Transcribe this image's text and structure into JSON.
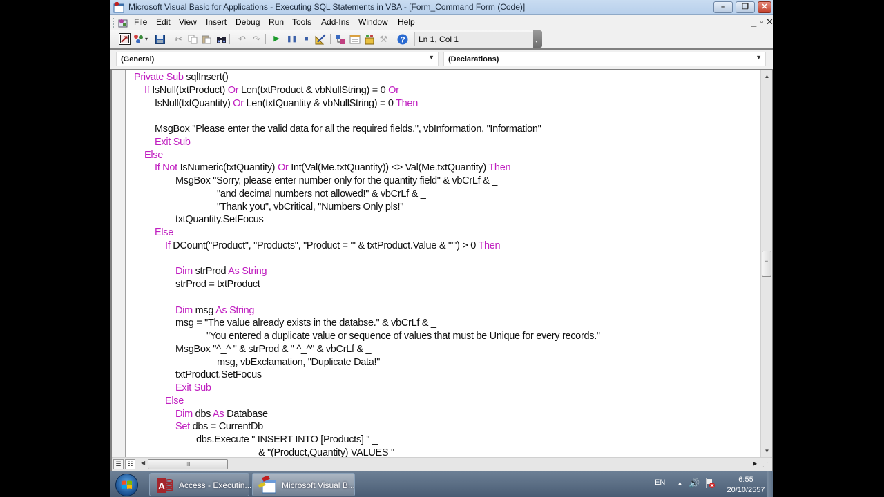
{
  "window": {
    "title": "Microsoft Visual Basic for Applications - Executing SQL Statements in VBA - [Form_Command Form (Code)]",
    "controls": {
      "minimize": "–",
      "restore": "❐",
      "close": "✕"
    }
  },
  "menubar": {
    "items": [
      {
        "label": "File",
        "accel": "F"
      },
      {
        "label": "Edit",
        "accel": "E"
      },
      {
        "label": "View",
        "accel": "V"
      },
      {
        "label": "Insert",
        "accel": "I"
      },
      {
        "label": "Debug",
        "accel": "D"
      },
      {
        "label": "Run",
        "accel": "R"
      },
      {
        "label": "Tools",
        "accel": "T"
      },
      {
        "label": "Add-Ins",
        "accel": "A"
      },
      {
        "label": "Window",
        "accel": "W"
      },
      {
        "label": "Help",
        "accel": "H"
      }
    ],
    "mdi_controls": {
      "minimize": "_",
      "restore": "🗗",
      "close": "✕"
    }
  },
  "toolbar": {
    "buttons": [
      {
        "name": "view-access-icon",
        "glyph": "◩"
      },
      {
        "name": "insert-module-icon",
        "glyph": "✤"
      },
      {
        "name": "insert-dropdown-icon",
        "glyph": "▾"
      },
      {
        "name": "save-icon",
        "glyph": "💾"
      },
      {
        "name": "cut-icon",
        "glyph": "✂"
      },
      {
        "name": "copy-icon",
        "glyph": "⎘"
      },
      {
        "name": "paste-icon",
        "glyph": "📋"
      },
      {
        "name": "find-icon",
        "glyph": "🔍"
      },
      {
        "name": "undo-icon",
        "glyph": "↶"
      },
      {
        "name": "redo-icon",
        "glyph": "↷"
      },
      {
        "name": "run-icon",
        "glyph": "▶"
      },
      {
        "name": "break-icon",
        "glyph": "❚❚"
      },
      {
        "name": "reset-icon",
        "glyph": "■"
      },
      {
        "name": "design-mode-icon",
        "glyph": "📐"
      },
      {
        "name": "project-explorer-icon",
        "glyph": "🗂"
      },
      {
        "name": "properties-window-icon",
        "glyph": "📄"
      },
      {
        "name": "object-browser-icon",
        "glyph": "🧰"
      },
      {
        "name": "toolbox-icon",
        "glyph": "⚒"
      },
      {
        "name": "help-icon",
        "glyph": "?"
      }
    ],
    "position": "Ln 1, Col 1"
  },
  "code_window": {
    "object_combo": "(General)",
    "procedure_combo": "(Declarations)",
    "lines": [
      {
        "indent": 0,
        "parts": [
          {
            "k": "Private Sub"
          },
          {
            "t": " sqlInsert()"
          }
        ]
      },
      {
        "indent": 1,
        "parts": [
          {
            "k": "If"
          },
          {
            "t": " IsNull(txtProduct) "
          },
          {
            "k": "Or"
          },
          {
            "t": " Len(txtProduct & vbNullString) = 0 "
          },
          {
            "k": "Or"
          },
          {
            "t": " _"
          }
        ]
      },
      {
        "indent": 2,
        "parts": [
          {
            "t": "IsNull(txtQuantity) "
          },
          {
            "k": "Or"
          },
          {
            "t": " Len(txtQuantity & vbNullString) = 0 "
          },
          {
            "k": "Then"
          }
        ]
      },
      {
        "indent": 0,
        "parts": []
      },
      {
        "indent": 2,
        "parts": [
          {
            "t": "MsgBox \"Please enter the valid data for all the required fields.\", vbInformation, \"Information\""
          }
        ]
      },
      {
        "indent": 2,
        "parts": [
          {
            "k": "Exit Sub"
          }
        ]
      },
      {
        "indent": 1,
        "parts": [
          {
            "k": "Else"
          }
        ]
      },
      {
        "indent": 2,
        "parts": [
          {
            "k": "If Not"
          },
          {
            "t": " IsNumeric(txtQuantity) "
          },
          {
            "k": "Or"
          },
          {
            "t": " Int(Val(Me.txtQuantity)) <> Val(Me.txtQuantity) "
          },
          {
            "k": "Then"
          }
        ]
      },
      {
        "indent": 4,
        "parts": [
          {
            "t": "MsgBox \"Sorry, please enter number only for the quantity field\" & vbCrLf & _"
          }
        ]
      },
      {
        "indent": 8,
        "parts": [
          {
            "t": "\"and decimal numbers not allowed!\" & vbCrLf & _"
          }
        ]
      },
      {
        "indent": 8,
        "parts": [
          {
            "t": "\"Thank you\", vbCritical, \"Numbers Only pls!\""
          }
        ]
      },
      {
        "indent": 4,
        "parts": [
          {
            "t": "txtQuantity.SetFocus"
          }
        ]
      },
      {
        "indent": 2,
        "parts": [
          {
            "k": "Else"
          }
        ]
      },
      {
        "indent": 3,
        "parts": [
          {
            "k": "If"
          },
          {
            "t": " DCount(\"Product\", \"Products\", \"Product = '\" & txtProduct.Value & \"'\") > 0 "
          },
          {
            "k": "Then"
          }
        ]
      },
      {
        "indent": 0,
        "parts": []
      },
      {
        "indent": 4,
        "parts": [
          {
            "k": "Dim"
          },
          {
            "t": " strProd "
          },
          {
            "k": "As String"
          }
        ]
      },
      {
        "indent": 4,
        "parts": [
          {
            "t": "strProd = txtProduct"
          }
        ]
      },
      {
        "indent": 0,
        "parts": []
      },
      {
        "indent": 4,
        "parts": [
          {
            "k": "Dim"
          },
          {
            "t": " msg "
          },
          {
            "k": "As String"
          }
        ]
      },
      {
        "indent": 4,
        "parts": [
          {
            "t": "msg = \"The value already exists in the databse.\" & vbCrLf & _"
          }
        ]
      },
      {
        "indent": 7,
        "parts": [
          {
            "t": "\"You entered a duplicate value or sequence of values that must be Unique for every records.\""
          }
        ]
      },
      {
        "indent": 4,
        "parts": [
          {
            "t": "MsgBox \"^_^ \" & strProd & \" ^_^\" & vbCrLf & _"
          }
        ]
      },
      {
        "indent": 8,
        "parts": [
          {
            "t": "msg, vbExclamation, \"Duplicate Data!\""
          }
        ]
      },
      {
        "indent": 4,
        "parts": [
          {
            "t": "txtProduct.SetFocus"
          }
        ]
      },
      {
        "indent": 4,
        "parts": [
          {
            "k": "Exit Sub"
          }
        ]
      },
      {
        "indent": 3,
        "parts": [
          {
            "k": "Else"
          }
        ]
      },
      {
        "indent": 4,
        "parts": [
          {
            "k": "Dim"
          },
          {
            "t": " dbs "
          },
          {
            "k": "As"
          },
          {
            "t": " Database"
          }
        ]
      },
      {
        "indent": 4,
        "parts": [
          {
            "k": "Set"
          },
          {
            "t": " dbs = CurrentDb"
          }
        ]
      },
      {
        "indent": 6,
        "parts": [
          {
            "t": "dbs.Execute \" INSERT INTO [Products] \" _"
          }
        ]
      },
      {
        "indent": 12,
        "parts": [
          {
            "t": "& \"(Product,Quantity) VALUES \" _"
          }
        ]
      }
    ],
    "vscroll_position": 0.5,
    "keyword_color": "#c020c0",
    "text_color": "#111111"
  },
  "taskbar": {
    "tasks": [
      {
        "label": "Access - Executin...",
        "icon": "access-icon"
      },
      {
        "label": "Microsoft Visual B...",
        "icon": "vba-editor-icon",
        "active": true
      }
    ],
    "tray": {
      "language": "EN",
      "time": "6:55",
      "date": "20/10/2557"
    }
  }
}
